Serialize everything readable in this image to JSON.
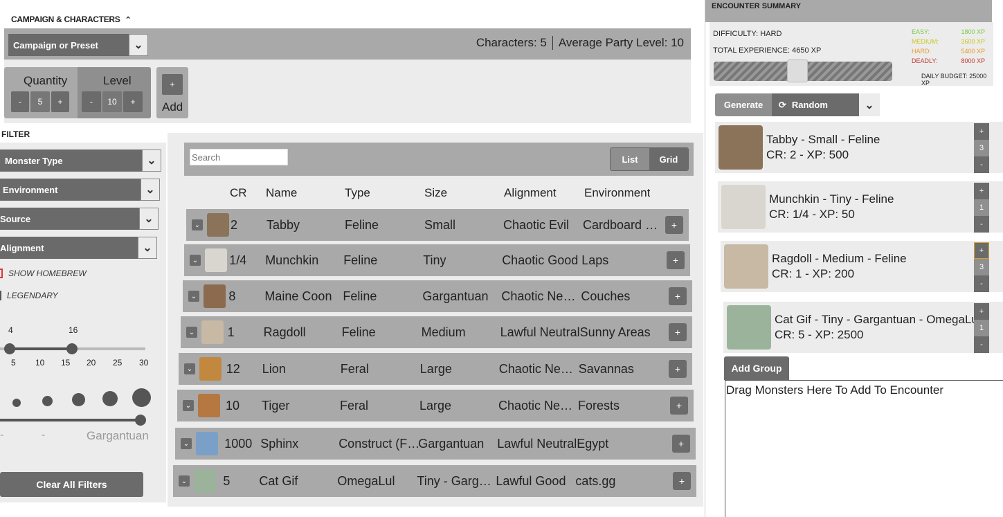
{
  "header": {
    "title": "CAMPAIGN & CHARACTERS",
    "collapse_icon": "^"
  },
  "campaign": {
    "dropdown_label": "Campaign or Preset",
    "characters_text": "Characters: 5",
    "apl_text": "Average Party Level: 10"
  },
  "quantity": {
    "label": "Quantity",
    "value": "5",
    "minus": "-",
    "plus": "+"
  },
  "level": {
    "label": "Level",
    "value": "10",
    "minus": "-",
    "plus": "+"
  },
  "add": {
    "plus": "+",
    "label": "Add"
  },
  "filter": {
    "title": "FILTER",
    "dropdowns": [
      "Monster Type",
      "Environment",
      "Source",
      "Alignment"
    ],
    "show_homebrew": "SHOW HOMEBREW",
    "legendary": "LEGENDARY",
    "cr_top_labels": [
      "4",
      "16"
    ],
    "cr_ticks": [
      "5",
      "10",
      "15",
      "20",
      "25",
      "30"
    ],
    "size_labels": [
      "-",
      "-",
      "Gargantuan"
    ],
    "clear_label": "Clear All Filters"
  },
  "table": {
    "search_placeholder": "Search",
    "view_list": "List",
    "view_grid": "Grid",
    "columns": [
      "CR",
      "Name",
      "Type",
      "Size",
      "Alignment",
      "Environment"
    ],
    "rows": [
      {
        "cr": "2",
        "name": "Tabby",
        "type": "Feline",
        "size": "Small",
        "alignment": "Chaotic Evil",
        "environment": "Cardboard Boxes",
        "thumb": "#8a7358"
      },
      {
        "cr": "1/4",
        "name": "Munchkin",
        "type": "Feline",
        "size": "Tiny",
        "alignment": "Chaotic Good",
        "environment": "Laps",
        "thumb": "#d9d6d0"
      },
      {
        "cr": "8",
        "name": "Maine Coon",
        "type": "Feline",
        "size": "Gargantuan",
        "alignment": "Chaotic Neutral",
        "environment": "Couches",
        "thumb": "#8b6a4e"
      },
      {
        "cr": "1",
        "name": "Ragdoll",
        "type": "Feline",
        "size": "Medium",
        "alignment": "Lawful Neutral",
        "environment": "Sunny Areas",
        "thumb": "#c7b9a3"
      },
      {
        "cr": "12",
        "name": "Lion",
        "type": "Feral",
        "size": "Large",
        "alignment": "Chaotic Neutral",
        "environment": "Savannas",
        "thumb": "#c2883f"
      },
      {
        "cr": "10",
        "name": "Tiger",
        "type": "Feral",
        "size": "Large",
        "alignment": "Chaotic Neutral",
        "environment": "Forests",
        "thumb": "#b57840"
      },
      {
        "cr": "1000",
        "name": "Sphinx",
        "type": "Construct (Feline)",
        "size": "Gargantuan",
        "alignment": "Lawful Neutral",
        "environment": "Egypt",
        "thumb": "#7aa0c8"
      },
      {
        "cr": "5",
        "name": "Cat Gif",
        "type": "OmegaLul",
        "size": "Tiny - Gargantuan",
        "alignment": "Lawful Good",
        "environment": "cats.gg",
        "thumb": "#9bb39a"
      }
    ]
  },
  "encounter": {
    "title": "ENCOUNTER SUMMARY",
    "difficulty": "DIFFICULTY:  HARD",
    "total_xp": "TOTAL EXPERIENCE:  4650 XP",
    "thresholds": [
      {
        "label": "EASY:",
        "value": "1800 XP",
        "color": "#7ac943"
      },
      {
        "label": "MEDIUM:",
        "value": "3600 XP",
        "color": "#c8c820"
      },
      {
        "label": "HARD:",
        "value": "5400 XP",
        "color": "#e89a2b"
      },
      {
        "label": "DEADLY:",
        "value": "8000 XP",
        "color": "#c0392b"
      }
    ],
    "daily_budget": "DAILY BUDGET:  25000 XP",
    "progress_fraction": 0.47,
    "generate_label": "Generate",
    "random_label": "Random",
    "groups": [
      {
        "line1": "Tabby - Small - Feline",
        "line2": "CR: 2 - XP: 500",
        "qty": "3",
        "thumb": "#8a7358"
      },
      {
        "line1": "Munchkin - Tiny - Feline",
        "line2": "CR: 1/4 - XP: 50",
        "qty": "1",
        "thumb": "#d9d6d0"
      },
      {
        "line1": "Ragdoll - Medium - Feline",
        "line2": "CR: 1 - XP: 200",
        "qty": "3",
        "thumb": "#c7b9a3"
      },
      {
        "line1": "Cat Gif - Tiny - Gargantuan - OmegaLul",
        "line2": "CR: 5 - XP: 2500",
        "qty": "1",
        "thumb": "#9bb39a"
      }
    ],
    "add_group_label": "Add Group",
    "drop_text": "Drag Monsters Here To Add To Encounter"
  }
}
